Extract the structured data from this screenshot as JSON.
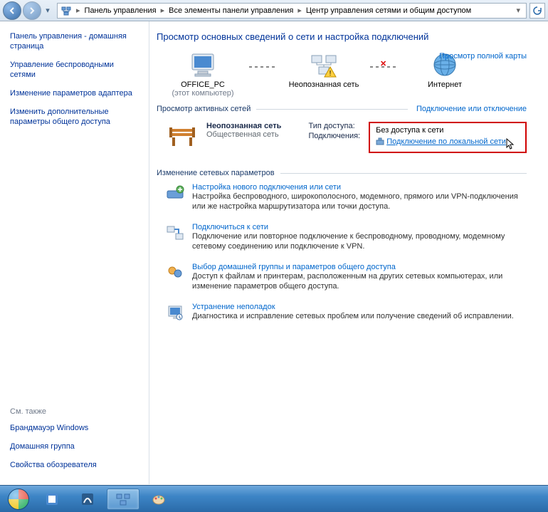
{
  "breadcrumb": {
    "seg1": "Панель управления",
    "seg2": "Все элементы панели управления",
    "seg3": "Центр управления сетями и общим доступом"
  },
  "sidebar": {
    "home": "Панель управления - домашняя страница",
    "links": [
      "Управление беспроводными сетями",
      "Изменение параметров адаптера",
      "Изменить дополнительные параметры общего доступа"
    ],
    "see_also_hdr": "См. также",
    "see_also": [
      "Брандмауэр Windows",
      "Домашняя группа",
      "Свойства обозревателя"
    ]
  },
  "content": {
    "heading": "Просмотр основных сведений о сети и настройка подключений",
    "map": {
      "pc_name": "OFFICE_PC",
      "pc_sub": "(этот компьютер)",
      "unknown": "Неопознанная сеть",
      "internet": "Интернет",
      "full_map": "Просмотр полной карты"
    },
    "active_hdr": "Просмотр активных сетей",
    "active_link": "Подключение или отключение",
    "active_net": {
      "name": "Неопознанная сеть",
      "type": "Общественная сеть",
      "access_lbl": "Тип доступа:",
      "access_val": "Без доступа к сети",
      "conn_lbl": "Подключения:",
      "conn_val": "Подключение по локальной сети"
    },
    "change_hdr": "Изменение сетевых параметров",
    "tasks": [
      {
        "title": "Настройка нового подключения или сети",
        "desc": "Настройка беспроводного, широкополосного, модемного, прямого или VPN-подключения или же настройка маршрутизатора или точки доступа."
      },
      {
        "title": "Подключиться к сети",
        "desc": "Подключение или повторное подключение к беспроводному, проводному, модемному сетевому соединению или подключение к VPN."
      },
      {
        "title": "Выбор домашней группы и параметров общего доступа",
        "desc": "Доступ к файлам и принтерам, расположенным на других сетевых компьютерах, или изменение параметров общего доступа."
      },
      {
        "title": "Устранение неполадок",
        "desc": "Диагностика и исправление сетевых проблем или получение сведений об исправлении."
      }
    ]
  }
}
